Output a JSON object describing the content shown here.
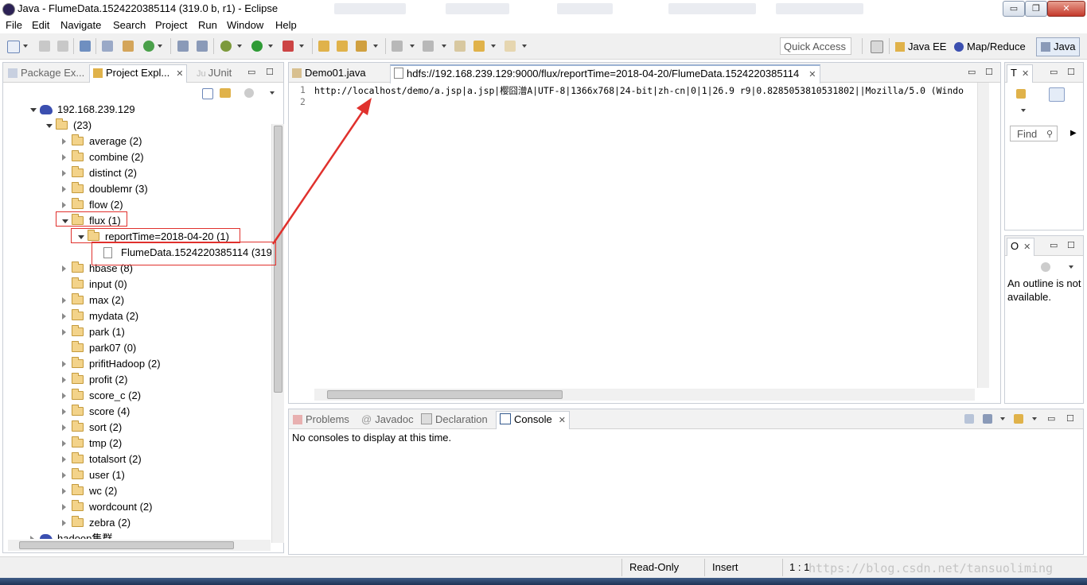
{
  "window": {
    "title": "Java - FlumeData.1524220385114 (319.0 b, r1) - Eclipse",
    "min_glyph": "▭",
    "max_glyph": "❐",
    "close_glyph": "✕"
  },
  "menu": [
    "File",
    "Edit",
    "Navigate",
    "Search",
    "Project",
    "Run",
    "Window",
    "Help"
  ],
  "toolbar": {
    "quick_access_placeholder": "Quick Access",
    "perspectives": [
      {
        "label": "Java EE"
      },
      {
        "label": "Map/Reduce"
      },
      {
        "label": "Java"
      }
    ]
  },
  "left_panel": {
    "tabs": [
      "Package Ex...",
      "Project Expl...",
      "JUnit"
    ],
    "tree": [
      {
        "label": "192.168.239.129",
        "icon": "elephant-icon",
        "state": "expanded"
      },
      {
        "label": "(23)",
        "icon": "folder-icon",
        "state": "expanded"
      },
      {
        "label": "average (2)",
        "icon": "folder-icon",
        "state": "collapsed"
      },
      {
        "label": "combine (2)",
        "icon": "folder-icon",
        "state": "collapsed"
      },
      {
        "label": "distinct (2)",
        "icon": "folder-icon",
        "state": "collapsed"
      },
      {
        "label": "doublemr (3)",
        "icon": "folder-icon",
        "state": "collapsed"
      },
      {
        "label": "flow (2)",
        "icon": "folder-icon",
        "state": "collapsed"
      },
      {
        "label": "flux (1)",
        "icon": "folder-icon",
        "state": "expanded"
      },
      {
        "label": "reportTime=2018-04-20 (1)",
        "icon": "folder-icon",
        "state": "expanded"
      },
      {
        "label": "FlumeData.1524220385114 (319.",
        "icon": "file-icon",
        "state": "leaf"
      },
      {
        "label": "hbase (8)",
        "icon": "folder-icon",
        "state": "collapsed"
      },
      {
        "label": "input (0)",
        "icon": "folder-icon",
        "state": "leaf"
      },
      {
        "label": "max (2)",
        "icon": "folder-icon",
        "state": "collapsed"
      },
      {
        "label": "mydata (2)",
        "icon": "folder-icon",
        "state": "collapsed"
      },
      {
        "label": "park (1)",
        "icon": "folder-icon",
        "state": "collapsed"
      },
      {
        "label": "park07 (0)",
        "icon": "folder-icon",
        "state": "leaf"
      },
      {
        "label": "prifitHadoop (2)",
        "icon": "folder-icon",
        "state": "collapsed"
      },
      {
        "label": "profit (2)",
        "icon": "folder-icon",
        "state": "collapsed"
      },
      {
        "label": "score_c (2)",
        "icon": "folder-icon",
        "state": "collapsed"
      },
      {
        "label": "score (4)",
        "icon": "folder-icon",
        "state": "collapsed"
      },
      {
        "label": "sort (2)",
        "icon": "folder-icon",
        "state": "collapsed"
      },
      {
        "label": "tmp (2)",
        "icon": "folder-icon",
        "state": "collapsed"
      },
      {
        "label": "totalsort (2)",
        "icon": "folder-icon",
        "state": "collapsed"
      },
      {
        "label": "user (1)",
        "icon": "folder-icon",
        "state": "collapsed"
      },
      {
        "label": "wc (2)",
        "icon": "folder-icon",
        "state": "collapsed"
      },
      {
        "label": "wordcount (2)",
        "icon": "folder-icon",
        "state": "collapsed"
      },
      {
        "label": "zebra (2)",
        "icon": "folder-icon",
        "state": "collapsed"
      },
      {
        "label": "hadoop集群",
        "icon": "elephant-icon",
        "state": "collapsed"
      }
    ]
  },
  "editor": {
    "tabs": [
      {
        "label": "Demo01.java"
      },
      {
        "label": "hdfs://192.168.239.129:9000/flux/reportTime=2018-04-20/FlumeData.1524220385114"
      }
    ],
    "lines": [
      {
        "num": "1",
        "text": "http://localhost/demo/a.jsp|a.jsp|樱囧潧A|UTF-8|1366x768|24-bit|zh-cn|0|1|26.9 r9|0.8285053810531802||Mozilla/5.0 (Windo"
      },
      {
        "num": "2",
        "text": ""
      }
    ]
  },
  "right_top": {
    "tab": "T",
    "find_placeholder": "Find"
  },
  "outline": {
    "tab": "O",
    "message": "An outline is not available."
  },
  "bottom": {
    "tabs": [
      "Problems",
      "Javadoc",
      "Declaration",
      "Console"
    ],
    "console_message": "No consoles to display at this time."
  },
  "status": {
    "mode": "Read-Only",
    "insert": "Insert",
    "position": "1 : 1"
  },
  "watermark": "https://blog.csdn.net/tansuoliming",
  "colors": {
    "annotation": "#e0312d",
    "folder": "#f3d38a",
    "hadoop": "#3b4fb0"
  }
}
